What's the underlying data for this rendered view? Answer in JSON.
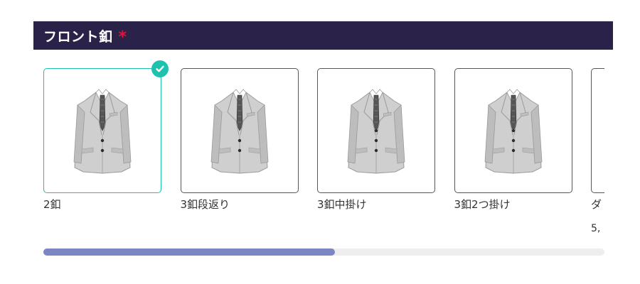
{
  "section": {
    "title": "フロント釦",
    "required_mark": "*"
  },
  "options": [
    {
      "label": "2釦",
      "buttons": 2,
      "selected": true
    },
    {
      "label": "3釦段返り",
      "buttons": 2,
      "selected": false
    },
    {
      "label": "3釦中掛け",
      "buttons": 3,
      "selected": false
    },
    {
      "label": "3釦2つ掛け",
      "buttons": 3,
      "selected": false
    },
    {
      "label": "ダ",
      "price": "5,",
      "buttons": 2,
      "selected": false
    }
  ],
  "scrollbar": {
    "position_fraction": 0.52
  },
  "colors": {
    "header_bg": "#2b2249",
    "required": "#e0143c",
    "selected_border": "#1cc2ad",
    "check_badge": "#1cc2ad",
    "scrollbar_thumb": "#7b86c3",
    "scrollbar_track": "#eeeeee"
  },
  "icons": {
    "selected_badge": "check-icon",
    "thumbnail": "suit-jacket-icon"
  }
}
